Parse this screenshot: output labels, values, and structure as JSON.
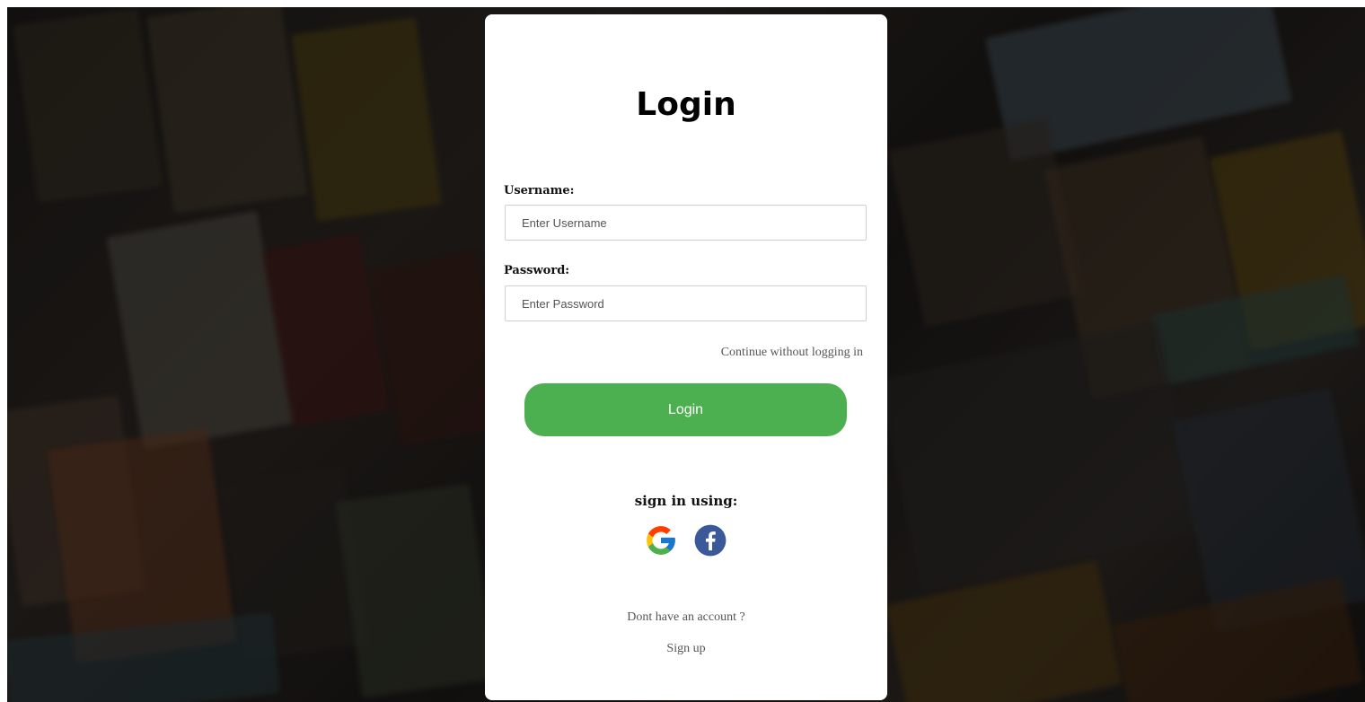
{
  "login_form": {
    "title": "Login",
    "username": {
      "label": "Username:",
      "value": "",
      "placeholder": "Enter Username"
    },
    "password": {
      "label": "Password:",
      "value": "",
      "placeholder": "Enter Password"
    },
    "continue_without_login": "Continue without logging in",
    "login_button": "Login",
    "sign_in_using": "sign in using:",
    "social_providers": [
      {
        "name": "Google",
        "icon": "google-icon"
      },
      {
        "name": "Facebook",
        "icon": "facebook-icon"
      }
    ],
    "no_account_text": "Dont have an account ?",
    "sign_up_link": "Sign up"
  },
  "colors": {
    "login_button": "#4caf50",
    "card_background": "#ffffff",
    "facebook_blue": "#3b5998"
  }
}
